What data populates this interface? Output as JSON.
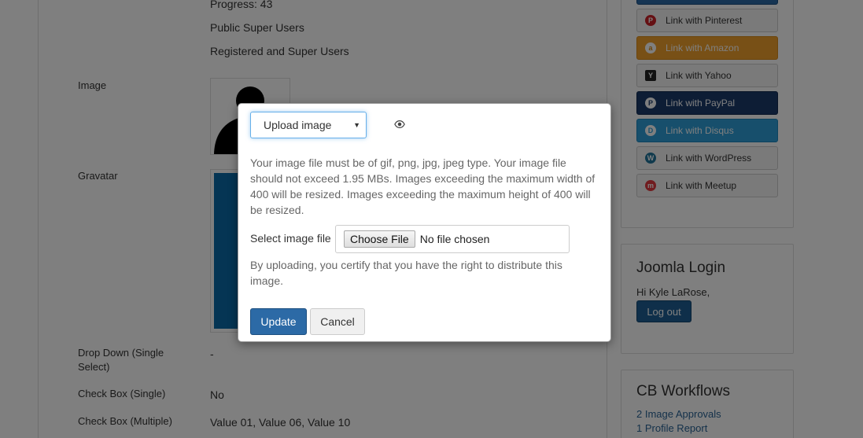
{
  "profile": {
    "progress_text": "Progress: 43",
    "access_public": "Public Super Users",
    "access_registered": "Registered and Super Users",
    "image_label": "Image",
    "gravatar_label": "Gravatar",
    "dropdown_label": "Drop Down (Single Select)",
    "dropdown_value": "-",
    "checkbox_single_label": "Check Box (Single)",
    "checkbox_single_value": "No",
    "checkbox_multiple_label": "Check Box (Multiple)",
    "checkbox_multiple_value": "Value 01, Value 06, Value 10"
  },
  "sidebar": {
    "social_buttons": [
      {
        "label": "Link with Pinterest",
        "icon": "pinterest-icon",
        "color": "#cb2027"
      },
      {
        "label": "Link with Amazon",
        "icon": "amazon-icon",
        "color": "#f0a02c"
      },
      {
        "label": "Link with Yahoo",
        "icon": "yahoo-icon",
        "color": "#222222"
      },
      {
        "label": "Link with PayPal",
        "icon": "paypal-icon",
        "color": "#1b3a6b"
      },
      {
        "label": "Link with Disqus",
        "icon": "disqus-icon",
        "color": "#2e9fd8"
      },
      {
        "label": "Link with WordPress",
        "icon": "wordpress-icon",
        "color": "#21759b"
      },
      {
        "label": "Link with Meetup",
        "icon": "meetup-icon",
        "color": "#e0393e"
      }
    ],
    "login": {
      "title": "Joomla Login",
      "greeting": "Hi Kyle LaRose,",
      "logout_label": "Log out"
    },
    "workflows": {
      "title": "CB Workflows",
      "links": [
        "2 Image Approvals",
        "1 Profile Report"
      ]
    }
  },
  "modal": {
    "select_value": "Upload image",
    "preview_icon": "eye-icon",
    "help_text": "Your image file must be of gif, png, jpg, jpeg type. Your image file should not exceed 1.95 MBs. Images exceeding the maximum width of 400 will be resized. Images exceeding the maximum height of 400 will be resized.",
    "file_label": "Select image file",
    "choose_file_label": "Choose File",
    "no_file_text": "No file chosen",
    "certify_text": "By uploading, you certify that you have the right to distribute this image.",
    "update_label": "Update",
    "cancel_label": "Cancel"
  },
  "colors": {
    "primary": "#2c6aa6",
    "overlay": "rgba(0,0,0,0.5)"
  }
}
